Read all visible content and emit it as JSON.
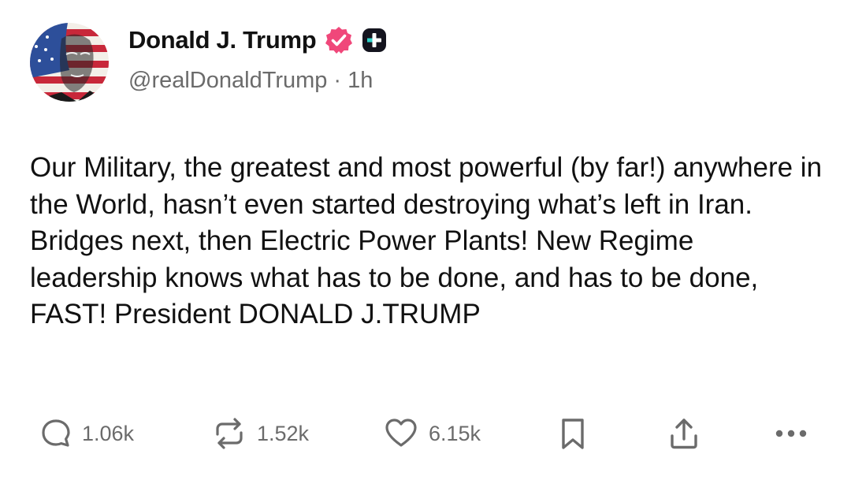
{
  "author": {
    "display_name": "Donald J. Trump",
    "handle": "@realDonaldTrump",
    "separator": "·",
    "time_ago": "1h",
    "verified_color": "#f0477a",
    "avatar_icon": "flag-portrait-avatar",
    "badge_icon": "plus-badge-icon"
  },
  "post": {
    "text": "Our Military, the greatest and most powerful (by far!) anywhere in the World, hasn’t even started destroying what’s left in Iran. Bridges next, then Electric Power Plants! New Regime leadership knows what has to be done, and has to be done, FAST! President DONALD J.TRUMP"
  },
  "actions": {
    "replies": "1.06k",
    "reposts": "1.52k",
    "likes": "6.15k",
    "icons": [
      "reply-icon",
      "repost-icon",
      "heart-icon",
      "bookmark-icon",
      "share-icon",
      "more-icon"
    ],
    "icon_color": "#6b6b6b"
  }
}
